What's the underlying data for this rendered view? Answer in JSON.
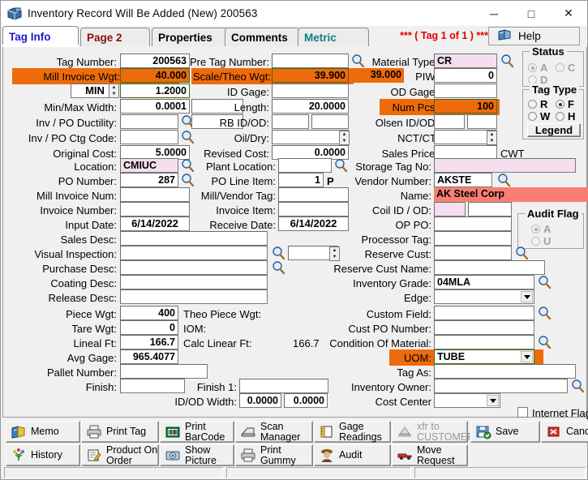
{
  "window": {
    "title": "Inventory Record Will Be Added  (New) 200563",
    "minimize": "─",
    "maximize": "□",
    "close": "✕"
  },
  "tabs": [
    {
      "label": "Tag Info",
      "color": "#1a1ad0",
      "active": true
    },
    {
      "label": "Page 2",
      "color": "#8a1010",
      "active": false
    },
    {
      "label": "Properties",
      "color": "#000000",
      "active": false
    },
    {
      "label": "Comments",
      "color": "#000000",
      "active": false
    },
    {
      "label": "Metric",
      "color": "#117f7f",
      "active": false
    }
  ],
  "header": {
    "tag_counter": "***   ( Tag 1 of 1 )   ***",
    "help_label": "Help"
  },
  "labels": {
    "tag_number": "Tag Number:",
    "pre_tag_number": "Pre Tag Number:",
    "material_type": "Material Type:",
    "mill_invoice_wgt": "Mill Invoice Wgt:",
    "scale_theo_wgt": "Scale/Theo Wgt:",
    "piw": "PIW:",
    "min": "MIN",
    "id_gage": "ID Gage:",
    "od_gage": "OD Gage:",
    "min_max_width": "Min/Max Width:",
    "length": "Length:",
    "num_pcs": "Num Pcs:",
    "inv_po_ductility": "Inv / PO Ductility:",
    "rb_id_od": "RB ID/OD:",
    "olsen_id_od": "Olsen ID/OD:",
    "inv_po_ctg_code": "Inv / PO Ctg Code:",
    "oil_dry": "Oil/Dry:",
    "nct_ct": "NCT/CT:",
    "original_cost": "Original Cost:",
    "revised_cost": "Revised Cost:",
    "sales_price": "Sales Price:",
    "cwt": "CWT",
    "location": "Location:",
    "plant_location": "Plant Location:",
    "storage_tag_no": "Storage Tag No:",
    "po_number": "PO Number:",
    "po_line_item": "PO Line Item:",
    "po_line_suffix": "P",
    "vendor_number": "Vendor Number:",
    "mill_invoice_num": "Mill Invoice Num:",
    "mill_vendor_tag": "Mill/Vendor Tag:",
    "name": "Name:",
    "invoice_number": "Invoice Number:",
    "invoice_item": "Invoice Item:",
    "coil_id_od": "Coil ID / OD:",
    "input_date": "Input Date:",
    "receive_date": "Receive Date:",
    "op_po": "OP PO:",
    "sales_desc": "Sales Desc:",
    "processor_tag": "Processor Tag:",
    "visual_inspection": "Visual Inspection:",
    "reserve_cust": "Reserve Cust:",
    "purchase_desc": "Purchase Desc:",
    "reserve_cust_name": "Reserve Cust Name:",
    "coating_desc": "Coating Desc:",
    "inventory_grade": "Inventory Grade:",
    "release_desc": "Release Desc:",
    "edge": "Edge:",
    "piece_wgt": "Piece Wgt:",
    "theo_piece_wgt": "Theo Piece Wgt:",
    "custom_field": "Custom Field:",
    "tare_wgt": "Tare Wgt:",
    "iom": "IOM:",
    "cust_po_number": "Cust PO Number:",
    "lineal_ft": "Lineal Ft:",
    "calc_linear_ft": "Calc Linear Ft:",
    "condition_of_material": "Condition Of Material:",
    "avg_gage": "Avg Gage:",
    "uom": "UOM:",
    "pallet_number": "Pallet Number:",
    "tag_as": "Tag As:",
    "finish": "Finish:",
    "finish_1": "Finish 1:",
    "inventory_owner": "Inventory Owner:",
    "id_od_width": "ID/OD Width:",
    "cost_center": "Cost Center",
    "internet_flag": "Internet Flag"
  },
  "values": {
    "tag_number": "200563",
    "pre_tag_number": "",
    "material_type": "CR",
    "mill_invoice_wgt": "40.000",
    "scale_wgt": "39.900",
    "theo_wgt": "39.000",
    "piw": "0",
    "min_select": "MIN",
    "min_value": "1.2000",
    "id_gage": "",
    "od_gage": "",
    "min_width": "0.0001",
    "max_width": "",
    "length": "20.0000",
    "num_pcs": "100",
    "inv_po_ductility": "",
    "inv_po_ductility2": "",
    "rb_id": "",
    "rb_od": "",
    "olsen_id": "",
    "olsen_od": "",
    "inv_po_ctg_code": "",
    "oil_dry": "",
    "nct_ct": "",
    "original_cost": "5.0000",
    "revised_cost": "0.0000",
    "sales_price": "",
    "location": "CMIUC",
    "plant_location": "",
    "storage_tag_no": "",
    "po_number": "287",
    "po_line_item": "1",
    "vendor_number": "AKSTE",
    "mill_invoice_num": "",
    "mill_vendor_tag": "",
    "vendor_name": "AK Steel Corp",
    "invoice_number": "",
    "invoice_item": "",
    "coil_id": "",
    "coil_od": "",
    "input_date": "6/14/2022",
    "receive_date": "6/14/2022",
    "op_po": "",
    "sales_desc": "",
    "processor_tag": "",
    "visual_inspection": "",
    "visual_inspection2": "",
    "reserve_cust": "",
    "reserve_cust2": "",
    "purchase_desc": "",
    "reserve_cust_name": "",
    "coating_desc": "",
    "inventory_grade": "04MLA",
    "release_desc": "",
    "edge": "",
    "piece_wgt": "400",
    "theo_piece_wgt": "",
    "custom_field": "",
    "tare_wgt": "0",
    "iom": "",
    "cust_po_number": "",
    "lineal_ft": "166.7",
    "calc_linear_ft": "166.7",
    "condition_of_material": "",
    "avg_gage": "965.4077",
    "uom": "TUBE",
    "pallet_number": "",
    "tag_as": "",
    "finish": "",
    "finish_1": "",
    "inventory_owner": "",
    "id_width": "0.0000",
    "od_width": "0.0000",
    "cost_center": ""
  },
  "status_group": {
    "caption": "Status",
    "options": [
      {
        "label": "A",
        "selected": true
      },
      {
        "label": "C",
        "selected": false
      },
      {
        "label": "D",
        "selected": false
      }
    ]
  },
  "tag_type_group": {
    "caption": "Tag Type",
    "options": [
      {
        "label": "R",
        "selected": false
      },
      {
        "label": "F",
        "selected": true
      },
      {
        "label": "W",
        "selected": false
      },
      {
        "label": "H",
        "selected": false
      }
    ],
    "legend_button": "Legend"
  },
  "audit_flag_group": {
    "caption": "Audit Flag",
    "options": [
      {
        "label": "A",
        "selected": true
      },
      {
        "label": "U",
        "selected": false
      }
    ]
  },
  "toolbar": {
    "row1": [
      {
        "label": "Memo",
        "icon": "memo-icon",
        "enabled": true
      },
      {
        "label": "Print Tag",
        "icon": "printer-icon",
        "enabled": true
      },
      {
        "label": "Print\nBarCode",
        "icon": "barcode-icon",
        "enabled": true
      },
      {
        "label": "Scan\nManager",
        "icon": "scanner-icon",
        "enabled": true
      },
      {
        "label": "Gage\nReadings",
        "icon": "gage-icon",
        "enabled": true
      },
      {
        "label": "xfr to\nCUSTOMER",
        "icon": "transfer-icon",
        "enabled": false
      },
      {
        "label": "Save",
        "icon": "save-icon",
        "enabled": true
      },
      {
        "label": "Cancel",
        "icon": "cancel-icon",
        "enabled": true
      }
    ],
    "row2": [
      {
        "label": "History",
        "icon": "history-icon",
        "enabled": true
      },
      {
        "label": "Product On\nOrder",
        "icon": "order-icon",
        "enabled": true
      },
      {
        "label": "Show\nPicture",
        "icon": "picture-icon",
        "enabled": true
      },
      {
        "label": "Print\nGummy",
        "icon": "printer2-icon",
        "enabled": true
      },
      {
        "label": "Audit",
        "icon": "detective-icon",
        "enabled": true
      },
      {
        "label": "Move\nRequest",
        "icon": "truck-icon",
        "enabled": true
      }
    ]
  },
  "colors": {
    "highlight_orange": "#ee6b0b",
    "alert_salmon": "#fa7f73",
    "lookup_pink": "#f5dfef",
    "accent_red": "#e00000",
    "tab_active": "#1a1ad0"
  }
}
